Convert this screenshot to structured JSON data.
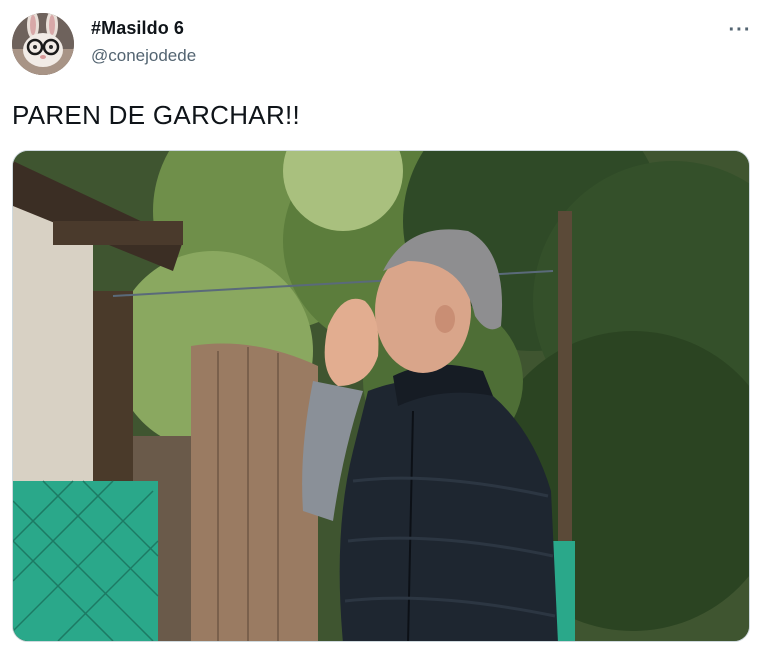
{
  "user": {
    "display_name": "#Masildo 6",
    "handle": "@conejodede",
    "avatar_icon": "rabbit-with-glasses-avatar"
  },
  "menu": {
    "more_label": "···",
    "more_icon": "more-dots-icon"
  },
  "tweet": {
    "text": "PAREN DE GARCHAR!!"
  },
  "media": {
    "kind": "photo"
  },
  "colors": {
    "text_primary": "#0f1419",
    "text_secondary": "#536471",
    "border": "#cfd9de"
  }
}
